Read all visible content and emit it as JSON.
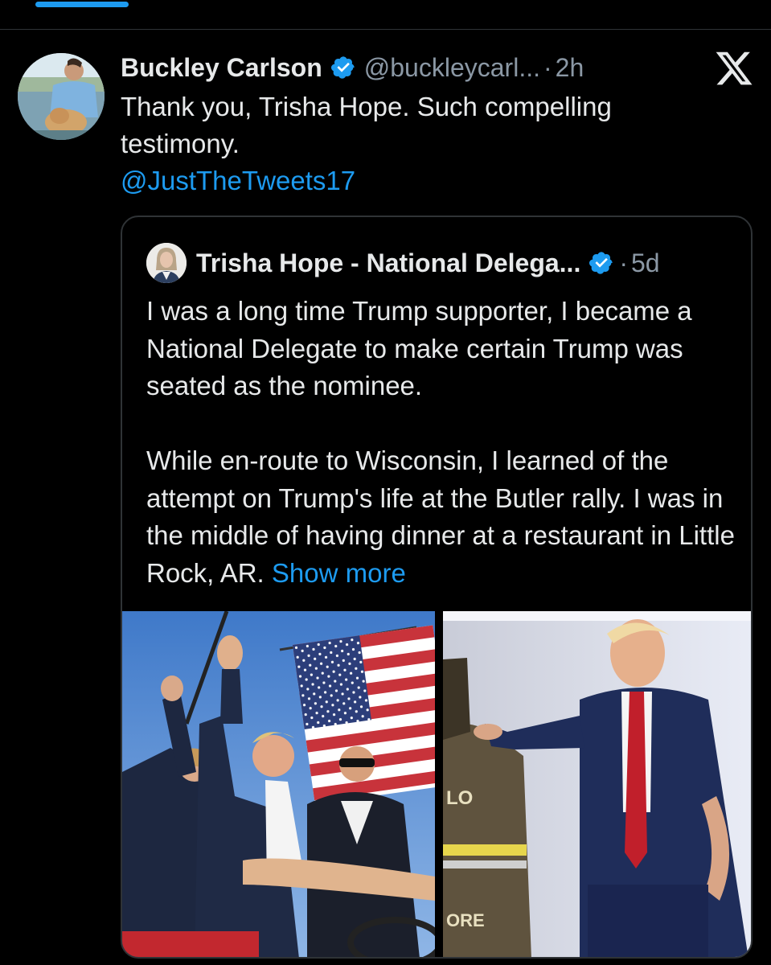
{
  "post": {
    "author": {
      "display_name": "Buckley Carlson",
      "handle": "@buckleycarl...",
      "separator": "·",
      "time": "2h",
      "verified": true,
      "avatar_icon": "profile-photo-man-with-dog"
    },
    "text": "Thank you, Trisha Hope. Such compelling testimony.",
    "mention": "@JustTheTweets17",
    "platform_icon": "x-logo-icon"
  },
  "quoted_post": {
    "author": {
      "display_name": "Trisha Hope - National Delega...",
      "separator": "·",
      "time": "5d",
      "verified": true,
      "avatar_icon": "profile-photo-woman"
    },
    "paragraph_1": "I was a long time Trump supporter, I became a National Delegate to make certain Trump was seated as the nominee.",
    "paragraph_2": "While en-route to Wisconsin, I learned of the attempt on Trump's life at the Butler rally.  I was in the middle of having dinner at a restaurant in Little Rock, AR.",
    "show_more": "Show more",
    "media": [
      {
        "icon": "photo-rally-flag",
        "sign_text": ""
      },
      {
        "icon": "photo-stage-firefighter-jacket",
        "jacket_text_top": "LO",
        "jacket_text_bottom": "ORE"
      }
    ]
  },
  "colors": {
    "background": "#000000",
    "text": "#e7e9ea",
    "secondary": "#8b98a5",
    "accent": "#1d9bf0",
    "border": "#2f3336"
  }
}
